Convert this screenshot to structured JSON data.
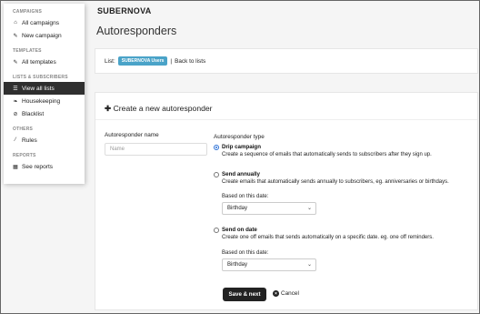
{
  "sidebar": {
    "sections": [
      {
        "label": "CAMPAIGNS",
        "items": [
          {
            "label": "All campaigns",
            "icon": "home-icon"
          },
          {
            "label": "New campaign",
            "icon": "edit-icon"
          }
        ]
      },
      {
        "label": "TEMPLATES",
        "items": [
          {
            "label": "All templates",
            "icon": "edit-icon"
          }
        ]
      },
      {
        "label": "LISTS & SUBSCRIBERS",
        "items": [
          {
            "label": "View all lists",
            "icon": "list-icon",
            "active": true
          },
          {
            "label": "Housekeeping",
            "icon": "leaf-icon"
          },
          {
            "label": "Blacklist",
            "icon": "ban-icon"
          }
        ]
      },
      {
        "label": "OTHERS",
        "items": [
          {
            "label": "Rules",
            "icon": "wand-icon"
          }
        ]
      },
      {
        "label": "REPORTS",
        "items": [
          {
            "label": "See reports",
            "icon": "report-icon"
          }
        ]
      }
    ]
  },
  "header": {
    "brand": "SUBERNOVA",
    "title": "Autoresponders"
  },
  "listbar": {
    "prefix": "List:",
    "list_name": "SUBERNOVA Users",
    "separator": "|",
    "back_label": "Back to lists"
  },
  "form": {
    "card_title": "Create a new autoresponder",
    "name_label": "Autoresponder name",
    "name_placeholder": "Name",
    "type_label": "Autoresponder type",
    "options": [
      {
        "title": "Drip campaign",
        "description": "Create a sequence of emails that automatically sends to subscribers after they sign up.",
        "selected": true
      },
      {
        "title": "Send annually",
        "description": "Create emails that automatically sends annually to subscribers, eg. anniversaries or birthdays.",
        "selected": false,
        "date_label": "Based on this date:",
        "date_value": "Birthday"
      },
      {
        "title": "Send on date",
        "description": "Create one off emails that sends automatically on a specific date. eg. one off reminders.",
        "selected": false,
        "date_label": "Based on this date:",
        "date_value": "Birthday"
      }
    ],
    "save_label": "Save & next",
    "cancel_label": "Cancel"
  },
  "colors": {
    "active_nav": "#2f2f2f",
    "list_pill": "#4aa3c8",
    "radio_selected": "#2a6fd6",
    "save_button": "#222222"
  }
}
